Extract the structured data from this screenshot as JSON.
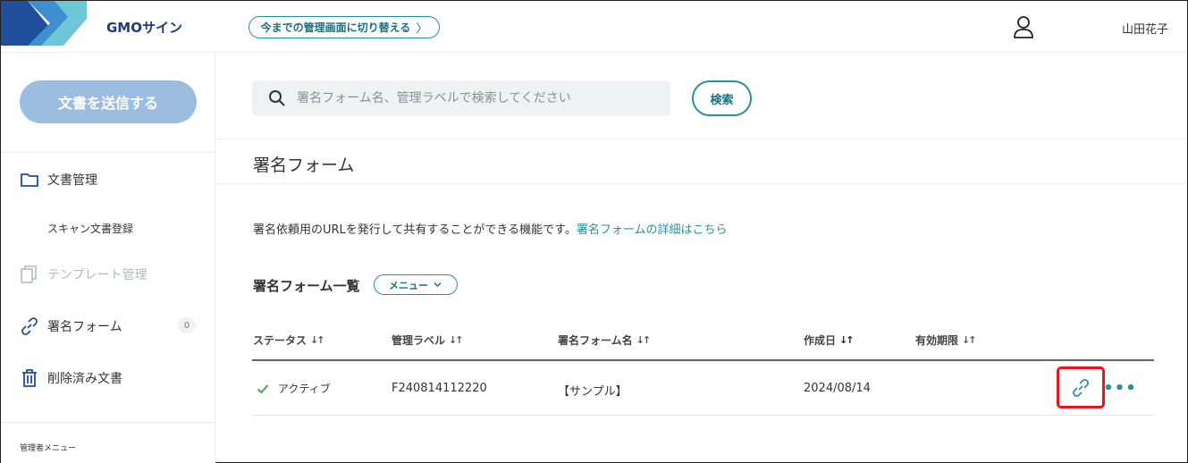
{
  "header": {
    "brand": "GMOサイン",
    "switch_label": "今までの管理画面に切り替える",
    "user_name": "山田花子"
  },
  "sidebar": {
    "send_button": "文書を送信する",
    "items": [
      {
        "label": "文書管理",
        "icon": "folder-icon"
      },
      {
        "label": "スキャン文書登録"
      },
      {
        "label": "テンプレート管理",
        "icon": "template-icon",
        "disabled": true
      },
      {
        "label": "署名フォーム",
        "icon": "link-icon",
        "badge": "0"
      },
      {
        "label": "削除済み文書",
        "icon": "trash-icon"
      }
    ],
    "admin_label": "管理者メニュー"
  },
  "search": {
    "placeholder": "署名フォーム名、管理ラベルで検索してください",
    "value": "",
    "button": "検索"
  },
  "page": {
    "title": "署名フォーム",
    "description": "署名依頼用のURLを発行して共有することができる機能です。",
    "description_link": "署名フォームの詳細はこちら",
    "list_title": "署名フォーム一覧",
    "menu_button": "メニュー"
  },
  "table": {
    "columns": [
      "ステータス",
      "管理ラベル",
      "署名フォーム名",
      "作成日",
      "有効期限"
    ],
    "rows": [
      {
        "status": "アクティブ",
        "label": "F240814112220",
        "name": "【サンプル】",
        "created": "2024/08/14",
        "expires": ""
      }
    ]
  },
  "colors": {
    "accent": "#2a8fa0",
    "send_button": "#9bbde0",
    "highlight": "#e8141e",
    "status_ok": "#3aa655"
  }
}
